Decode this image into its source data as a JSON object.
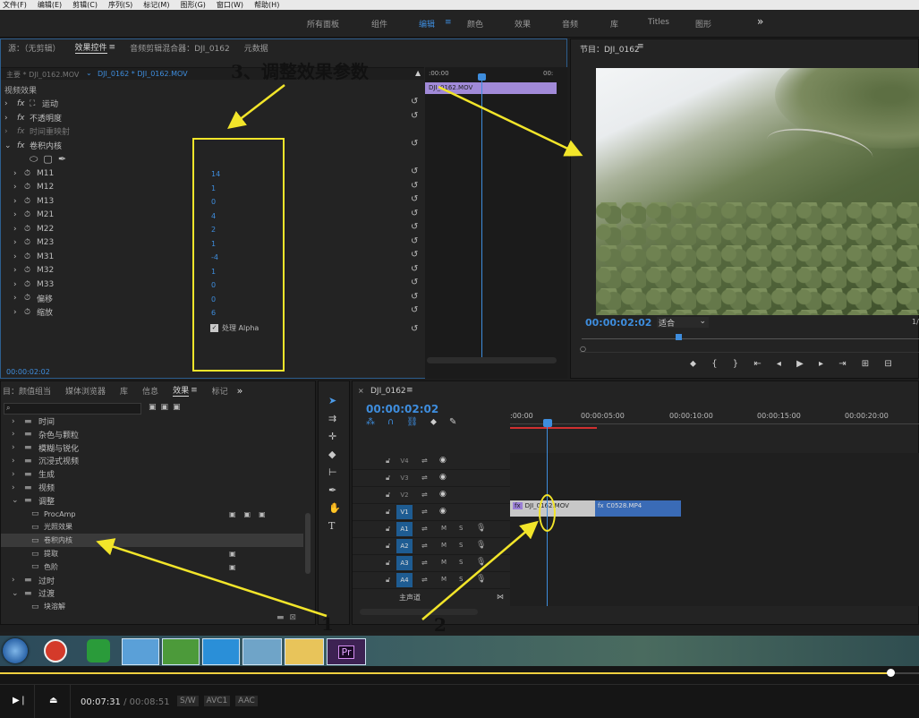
{
  "menu": [
    "文件(F)",
    "编辑(E)",
    "剪辑(C)",
    "序列(S)",
    "标记(M)",
    "图形(G)",
    "窗口(W)",
    "帮助(H)"
  ],
  "workspaces": [
    "所有面板",
    "组件",
    "编辑",
    "颜色",
    "效果",
    "音频",
    "库",
    "Titles",
    "图形"
  ],
  "workspace_more": "»",
  "effect_controls": {
    "tabs": [
      "源：（无剪辑）",
      "效果控件",
      "音频剪辑混合器：DJI_0162",
      "元数据"
    ],
    "master": "主要 * DJI_0162.MOV",
    "clip": "DJI_0162 * DJI_0162.MOV",
    "ruler_time": ":00:00",
    "ruler_time2": "00:",
    "clip_bar_label": "DJI_0162.MOV",
    "section_label": "视频效果",
    "fixed_effects": [
      "运动",
      "不透明度",
      "时间重映射"
    ],
    "effect_name": "卷积内核",
    "params": [
      {
        "name": "M11",
        "value": "14"
      },
      {
        "name": "M12",
        "value": "1"
      },
      {
        "name": "M13",
        "value": "0"
      },
      {
        "name": "M21",
        "value": "4"
      },
      {
        "name": "M22",
        "value": "2"
      },
      {
        "name": "M23",
        "value": "1"
      },
      {
        "name": "M31",
        "value": "-4"
      },
      {
        "name": "M32",
        "value": "1"
      },
      {
        "name": "M33",
        "value": "0"
      },
      {
        "name": "偏移",
        "value": "0"
      },
      {
        "name": "缩放",
        "value": "6"
      }
    ],
    "alpha_label": "处理 Alpha",
    "timecode": "00:00:02:02"
  },
  "program": {
    "title": "节目：DJI_0162",
    "timecode": "00:00:02:02",
    "fit": "适合",
    "fraction": "1/"
  },
  "project": {
    "tabs": [
      "目：颜值组当",
      "媒体浏览器",
      "库",
      "信息",
      "效果",
      "标记"
    ],
    "more": "»",
    "tree": [
      {
        "label": "时间",
        "indent": 1,
        "folder": true,
        "expanded": false
      },
      {
        "label": "杂色与颗粒",
        "indent": 1,
        "folder": true,
        "expanded": false
      },
      {
        "label": "模糊与锐化",
        "indent": 1,
        "folder": true,
        "expanded": false
      },
      {
        "label": "沉浸式视频",
        "indent": 1,
        "folder": true,
        "expanded": false
      },
      {
        "label": "生成",
        "indent": 1,
        "folder": true,
        "expanded": false
      },
      {
        "label": "视频",
        "indent": 1,
        "folder": true,
        "expanded": false
      },
      {
        "label": "调整",
        "indent": 1,
        "folder": true,
        "expanded": true
      },
      {
        "label": "ProcAmp",
        "indent": 2,
        "folder": false,
        "expanded": false
      },
      {
        "label": "光照效果",
        "indent": 2,
        "folder": false,
        "expanded": false
      },
      {
        "label": "卷积内核",
        "indent": 2,
        "folder": false,
        "expanded": false,
        "selected": true
      },
      {
        "label": "提取",
        "indent": 2,
        "folder": false,
        "expanded": false
      },
      {
        "label": "色阶",
        "indent": 2,
        "folder": false,
        "expanded": false
      },
      {
        "label": "过时",
        "indent": 1,
        "folder": true,
        "expanded": false
      },
      {
        "label": "过渡",
        "indent": 1,
        "folder": true,
        "expanded": true
      },
      {
        "label": "块溶解",
        "indent": 2,
        "folder": false,
        "expanded": false
      }
    ]
  },
  "timeline": {
    "tab": "DJI_0162",
    "timecode": "00:00:02:02",
    "ruler": [
      ":00:00",
      "00:00:05:00",
      "00:00:10:00",
      "00:00:15:00",
      "00:00:20:00"
    ],
    "tracks": [
      "V4",
      "V3",
      "V2",
      "V1",
      "A1",
      "A2",
      "A3",
      "A4"
    ],
    "master_label": "主声道",
    "clip1": "DJI_0162.MOV",
    "clip2": "C0528.MP4",
    "m": "M",
    "s": "S"
  },
  "annotations": {
    "step3": "3、调整效果参数",
    "n1": "1",
    "n2": "2"
  },
  "player": {
    "current": "00:07:31",
    "separator": "/",
    "total": "00:08:51",
    "tags": [
      "S/W",
      "AVC1",
      "AAC"
    ]
  },
  "taskbar": {
    "pr": "Pr"
  }
}
